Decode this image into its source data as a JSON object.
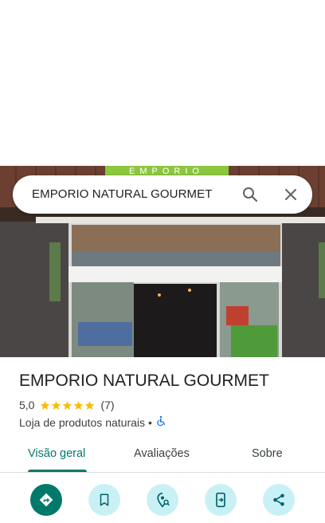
{
  "search": {
    "query": "EMPORIO NATURAL GOURMET"
  },
  "photo": {
    "sign_text": "EMPORIO"
  },
  "place": {
    "name": "EMPORIO NATURAL GOURMET",
    "rating": "5,0",
    "stars": 5,
    "reviews": "(7)",
    "category": "Loja de produtos naturais",
    "separator": "•"
  },
  "tabs": [
    {
      "label": "Visão geral",
      "active": true
    },
    {
      "label": "Avaliações",
      "active": false
    },
    {
      "label": "Sobre",
      "active": false
    }
  ],
  "actions": [
    {
      "icon": "directions-icon"
    },
    {
      "icon": "bookmark-icon"
    },
    {
      "icon": "nearby-icon"
    },
    {
      "icon": "send-to-phone-icon"
    },
    {
      "icon": "share-icon"
    }
  ],
  "colors": {
    "accent": "#00796b",
    "action_bg": "#c9f1f5",
    "star": "#fbbc04",
    "wheelchair": "#1a73e8"
  }
}
